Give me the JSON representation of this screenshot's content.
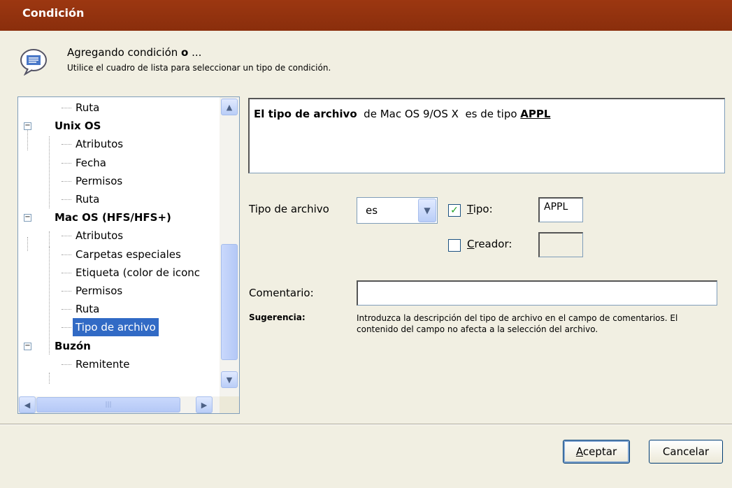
{
  "window": {
    "title": "Condición"
  },
  "header": {
    "title_prefix": "Agregando condición ",
    "title_bold": "o",
    "title_suffix": " ...",
    "subtitle": "Utilice el cuadro de lista para seleccionar un tipo de condición."
  },
  "tree": {
    "items": [
      {
        "label": "Ruta",
        "group": false
      },
      {
        "label": "Unix OS",
        "group": true
      },
      {
        "label": "Atributos",
        "group": false
      },
      {
        "label": "Fecha",
        "group": false
      },
      {
        "label": "Permisos",
        "group": false
      },
      {
        "label": "Ruta",
        "group": false
      },
      {
        "label": "Mac OS (HFS/HFS+)",
        "group": true
      },
      {
        "label": "Atributos",
        "group": false
      },
      {
        "label": "Carpetas especiales",
        "group": false
      },
      {
        "label": "Etiqueta (color de iconc",
        "group": false
      },
      {
        "label": "Permisos",
        "group": false
      },
      {
        "label": "Ruta",
        "group": false
      },
      {
        "label": "Tipo de archivo",
        "group": false,
        "selected": true
      },
      {
        "label": "Buzón",
        "group": true
      },
      {
        "label": "Remitente",
        "group": false
      }
    ]
  },
  "description": {
    "bold": "El tipo de archivo",
    "middle": "  de Mac OS 9/OS X  es de tipo ",
    "value": "APPL"
  },
  "form": {
    "file_type_label": "Tipo de archivo",
    "operator_value": "es",
    "type_checkbox_label": "Tipo:",
    "type_checked": true,
    "type_value": "APPL",
    "creator_checkbox_label": "Creador:",
    "creator_checked": false,
    "creator_value": "",
    "comment_label": "Comentario:",
    "comment_value": "",
    "hint_label": "Sugerencia:",
    "hint_text": "Introduzca la descripción del tipo de archivo en el campo de comentarios. El contenido del campo no afecta a la selección del archivo."
  },
  "buttons": {
    "ok": "Aceptar",
    "cancel": "Cancelar"
  },
  "colors": {
    "titlebar": "#9c3711",
    "selection": "#316ac5",
    "check": "#21a121"
  }
}
